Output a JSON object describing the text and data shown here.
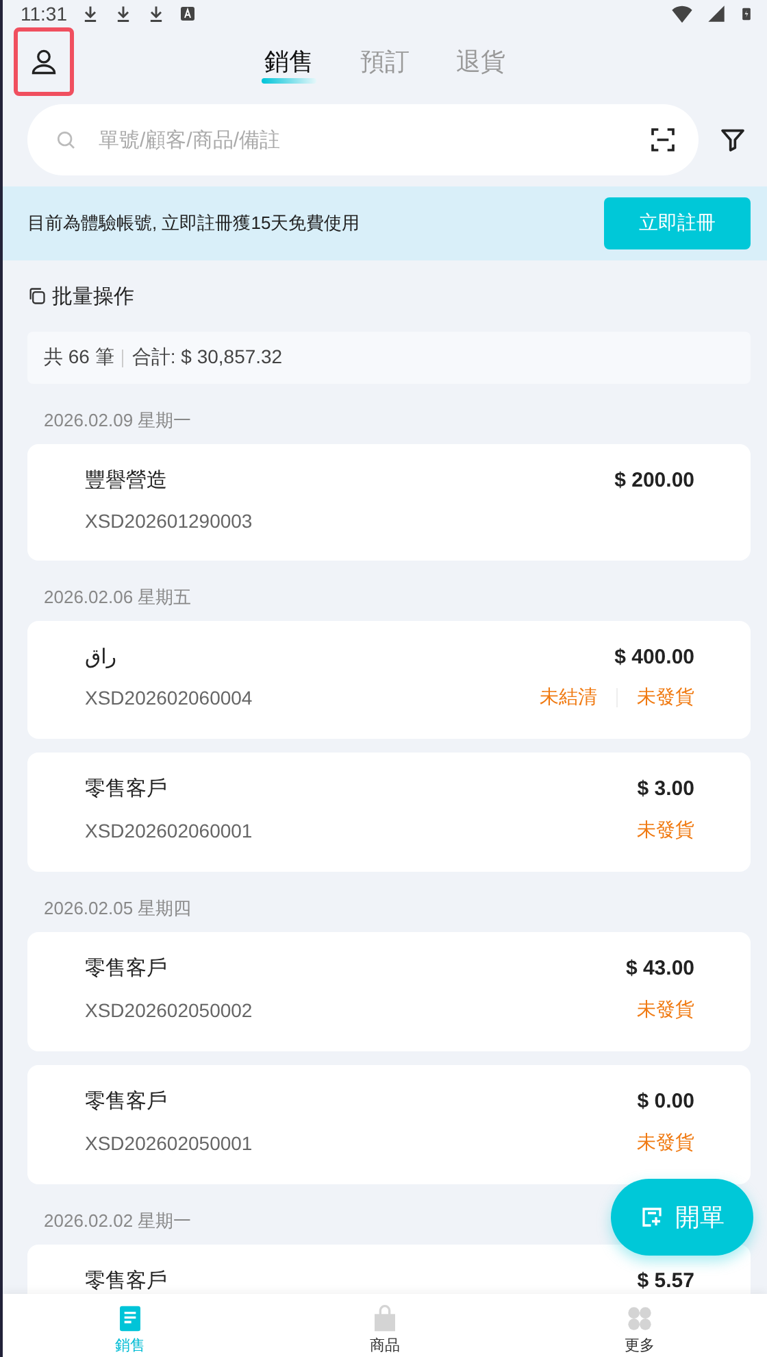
{
  "status_bar": {
    "time": "11:31"
  },
  "header": {
    "profile_highlighted": true,
    "tabs": [
      {
        "label": "銷售",
        "selected": true
      },
      {
        "label": "預訂",
        "selected": false
      },
      {
        "label": "退貨",
        "selected": false
      }
    ]
  },
  "search": {
    "placeholder": "單號/顧客/商品/備註"
  },
  "banner": {
    "text": "目前為體驗帳號, 立即註冊獲15天免費使用",
    "button": "立即註冊"
  },
  "bulk_action": "批量操作",
  "summary": {
    "count": "共 66 筆",
    "total": "合計: $ 30,857.32"
  },
  "groups": [
    {
      "date": "2026.02.09 星期一",
      "orders": [
        {
          "customer": "豐譽營造",
          "amount": "$ 200.00",
          "number": "XSD202601290003"
        }
      ]
    },
    {
      "date": "2026.02.06 星期五",
      "orders": [
        {
          "customer": "راق",
          "amount": "$ 400.00",
          "number": "XSD202602060004",
          "statuses": [
            "未結清",
            "未發貨"
          ]
        },
        {
          "customer": "零售客戶",
          "amount": "$ 3.00",
          "number": "XSD202602060001",
          "statuses": [
            "未發貨"
          ]
        }
      ]
    },
    {
      "date": "2026.02.05 星期四",
      "orders": [
        {
          "customer": "零售客戶",
          "amount": "$ 43.00",
          "number": "XSD202602050002",
          "statuses": [
            "未發貨"
          ]
        },
        {
          "customer": "零售客戶",
          "amount": "$ 0.00",
          "number": "XSD202602050001",
          "statuses": [
            "未發貨"
          ]
        }
      ]
    },
    {
      "date": "2026.02.02 星期一",
      "orders": [
        {
          "customer": "零售客戶",
          "amount": "$ 5.57"
        }
      ]
    }
  ],
  "fab": {
    "label": "開單"
  },
  "bottom_nav": [
    {
      "label": "銷售",
      "kind": "sales",
      "selected": true
    },
    {
      "label": "商品",
      "kind": "products",
      "selected": false
    },
    {
      "label": "更多",
      "kind": "more",
      "selected": false
    }
  ]
}
